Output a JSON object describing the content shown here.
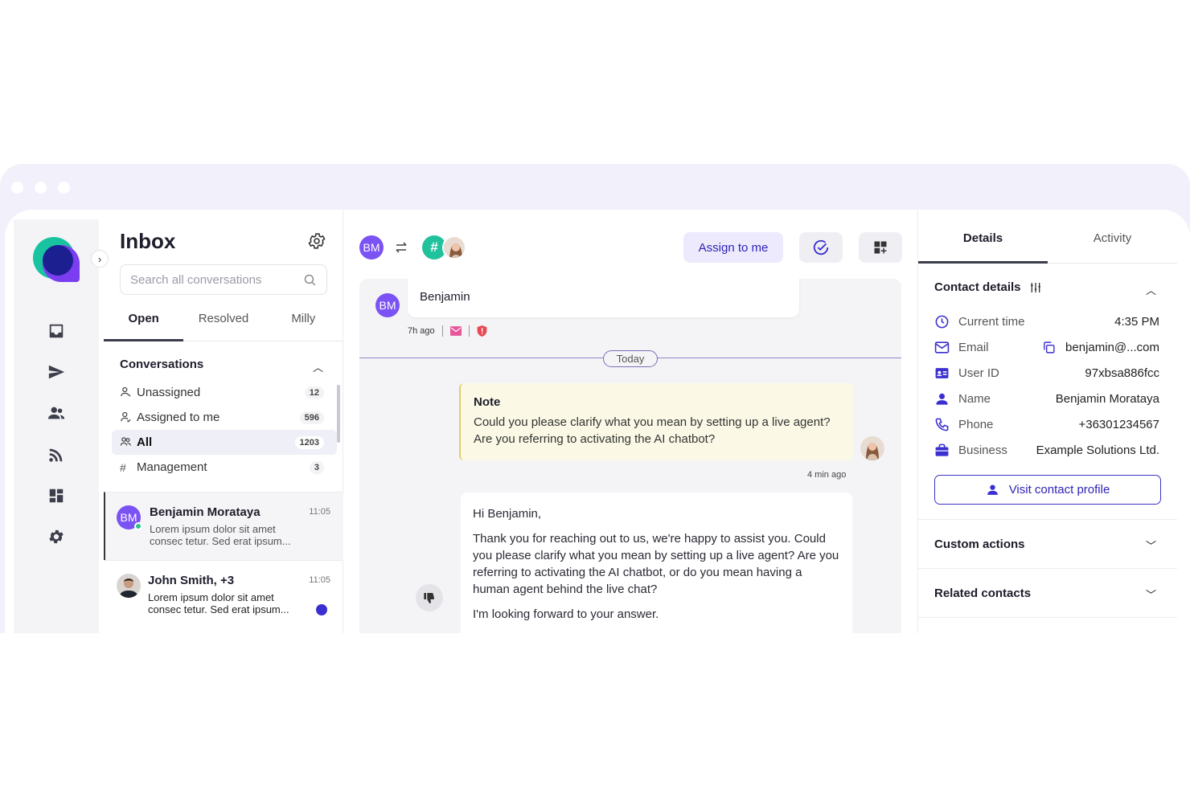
{
  "colors": {
    "accent": "#3a2fd1",
    "brand_green": "#19c3a0",
    "brand_purple": "#7a3df0"
  },
  "rail": {
    "icons": [
      "inbox-icon",
      "send-icon",
      "contacts-icon",
      "feed-icon",
      "dashboard-icon",
      "settings-icon"
    ]
  },
  "inbox": {
    "title": "Inbox",
    "search_placeholder": "Search all conversations",
    "tabs": [
      {
        "label": "Open"
      },
      {
        "label": "Resolved"
      },
      {
        "label": "Milly"
      }
    ],
    "section_title": "Conversations",
    "folders": [
      {
        "icon": "person-icon",
        "label": "Unassigned",
        "count": "12"
      },
      {
        "icon": "person-icon",
        "label": "Assigned to me",
        "count": "596"
      },
      {
        "icon": "people-icon",
        "label": "All",
        "count": "1203"
      },
      {
        "icon": "hash-icon",
        "label": "Management",
        "count": "3"
      }
    ],
    "conversations": [
      {
        "initials": "BM",
        "name": "Benjamin Morataya",
        "time": "11:05",
        "preview": "Lorem ipsum dolor sit amet consec tetur. Sed erat ipsum..."
      },
      {
        "name": "John Smith, +3",
        "time": "11:05",
        "preview": "Lorem ipsum dolor sit amet consec tetur. Sed erat ipsum..."
      }
    ]
  },
  "chat": {
    "header_initials": "BM",
    "assign_label": "Assign to me",
    "incoming": {
      "initials": "BM",
      "text": "Benjamin",
      "time": "7h ago"
    },
    "divider": "Today",
    "note": {
      "title": "Note",
      "body": "Could you please clarify what you mean by setting up a live agent? Are you referring to activating the AI chatbot?",
      "time": "4 min ago"
    },
    "reply": {
      "greeting": "Hi Benjamin,",
      "body": "Thank you for reaching out to us, we're happy to assist you. Could you please clarify what you mean by setting up a live agent? Are you referring to activating the AI chatbot, or do you mean having a human agent behind the live chat?",
      "closing": "I'm looking forward to your answer."
    }
  },
  "details": {
    "tabs": [
      {
        "label": "Details"
      },
      {
        "label": "Activity"
      }
    ],
    "contact_title": "Contact details",
    "rows": [
      {
        "icon": "clock-icon",
        "label": "Current time",
        "value": "4:35 PM"
      },
      {
        "icon": "mail-icon",
        "label": "Email",
        "value": "benjamin@...com"
      },
      {
        "icon": "id-card-icon",
        "label": "User ID",
        "value": "97xbsa886fcc"
      },
      {
        "icon": "person-icon",
        "label": "Name",
        "value": "Benjamin Morataya"
      },
      {
        "icon": "phone-icon",
        "label": "Phone",
        "value": "+36301234567"
      },
      {
        "icon": "briefcase-icon",
        "label": "Business",
        "value": "Example Solutions Ltd."
      }
    ],
    "visit_label": "Visit contact profile",
    "custom_actions": "Custom actions",
    "related_contacts": "Related contacts"
  }
}
